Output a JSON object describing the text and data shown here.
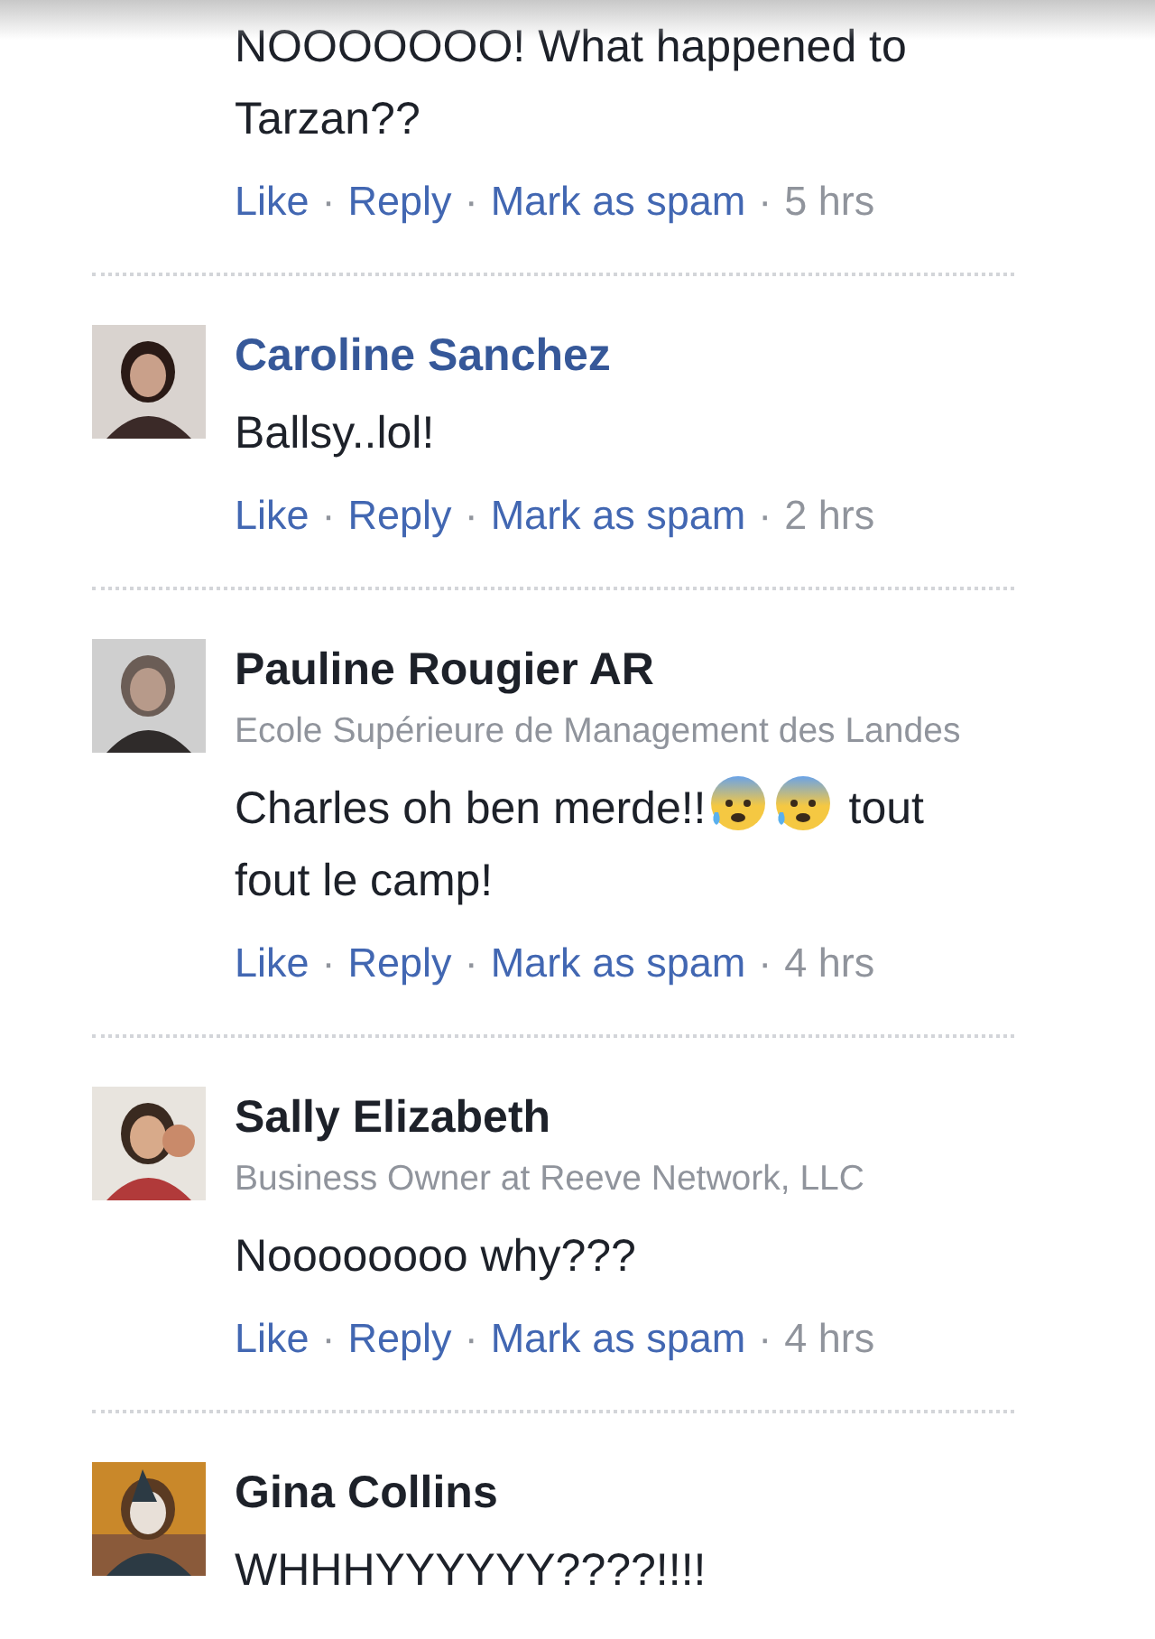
{
  "comments": [
    {
      "body": [
        {
          "kind": "text",
          "text": "NOOOOOOO! What happened to"
        },
        {
          "kind": "break"
        },
        {
          "kind": "text",
          "text": "Tarzan??"
        }
      ],
      "actions": [
        "Like",
        "Reply",
        "Mark as spam"
      ],
      "separator": "·",
      "time": "5 hrs"
    },
    {
      "name": "Caroline Sanchez",
      "highlighted": true,
      "body": [
        {
          "kind": "text",
          "text": "Ballsy..lol!"
        }
      ],
      "actions": [
        "Like",
        "Reply",
        "Mark as spam"
      ],
      "separator": "·",
      "time": "2 hrs"
    },
    {
      "name": "Pauline Rougier AR",
      "highlighted": false,
      "subtitle": "Ecole Supérieure de Management des Landes",
      "body": [
        {
          "kind": "text",
          "text": "Charles oh ben merde!!"
        },
        {
          "kind": "emoji"
        },
        {
          "kind": "emoji"
        },
        {
          "kind": "text",
          "text": "tout"
        },
        {
          "kind": "break"
        },
        {
          "kind": "text",
          "text": "fout le camp!"
        }
      ],
      "actions": [
        "Like",
        "Reply",
        "Mark as spam"
      ],
      "separator": "·",
      "time": "4 hrs"
    },
    {
      "name": "Sally Elizabeth",
      "highlighted": false,
      "subtitle": "Business Owner at Reeve Network, LLC",
      "body": [
        {
          "kind": "text",
          "text": "Noooooooo why???"
        }
      ],
      "actions": [
        "Like",
        "Reply",
        "Mark as spam"
      ],
      "separator": "·",
      "time": "4 hrs"
    },
    {
      "name": "Gina Collins",
      "highlighted": false,
      "body": [
        {
          "kind": "text",
          "text": "WHHHYYYYYY????!!!!"
        }
      ]
    }
  ]
}
